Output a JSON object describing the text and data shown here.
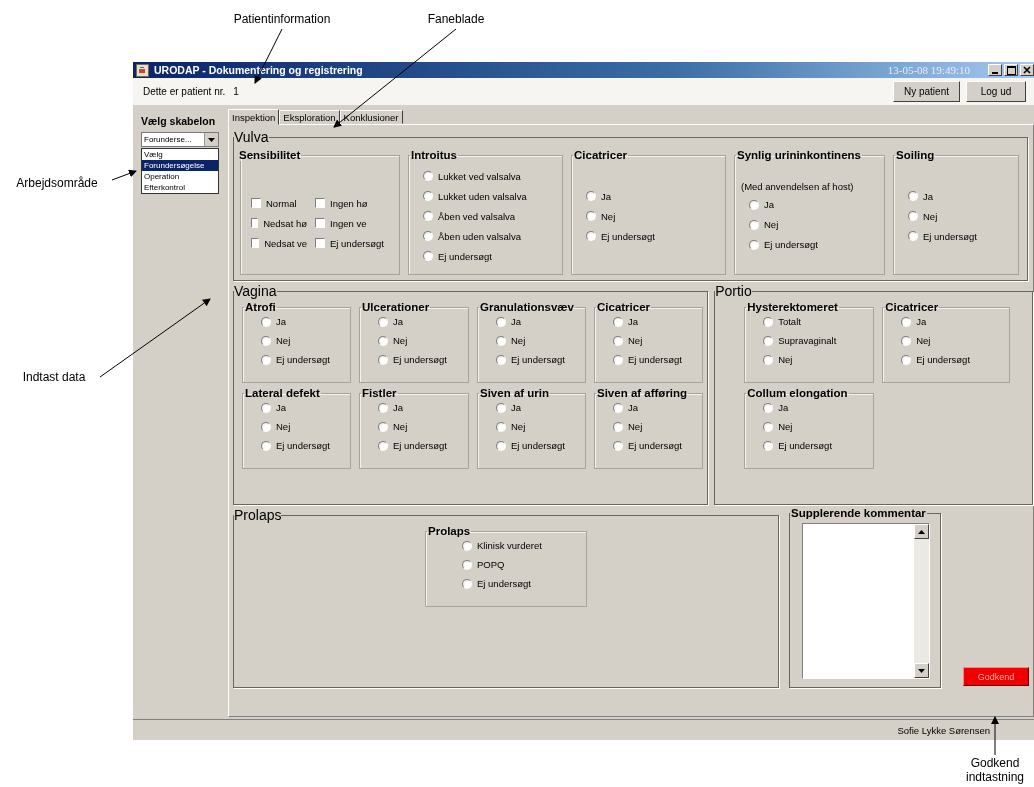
{
  "annotations": [
    {
      "text": "Patientinformation"
    },
    {
      "text": "Faneblade"
    },
    {
      "text": "Arbejdsområde"
    },
    {
      "text": "Indtast data"
    },
    {
      "text": "Godkend indtastning"
    }
  ],
  "window": {
    "title": "URODAP - Dokumentering og registrering",
    "datetime": "13-05-08 19:49:10"
  },
  "patient_bar": {
    "label": "Dette er patient nr.",
    "number": "1",
    "buttons": [
      "Ny patient",
      "Log ud"
    ]
  },
  "sidebar": {
    "heading": "Vælg skabelon",
    "combo_value": "Forunderse...",
    "dropdown_items": [
      {
        "label": "Vælg",
        "selected": false
      },
      {
        "label": "Forundersøgelse",
        "selected": true
      },
      {
        "label": "Operation",
        "selected": false
      },
      {
        "label": "Efterkontrol",
        "selected": false
      }
    ]
  },
  "tabs": [
    {
      "label": "Inspektion",
      "selected": true
    },
    {
      "label": "Eksploration",
      "selected": false
    },
    {
      "label": "Konklusioner",
      "selected": false
    }
  ],
  "sections": [
    {
      "title": "Vulva",
      "groups": [
        {
          "title": "Sensibilitet",
          "kind": "checkbox",
          "options": [
            {
              "label": "Normal",
              "checked": false
            },
            {
              "label": "Nedsat hø",
              "checked": false
            },
            {
              "label": "Nedsat ve",
              "checked": false
            },
            {
              "label": "Ingen hø",
              "checked": false
            },
            {
              "label": "Ingen ve",
              "checked": false
            },
            {
              "label": "Ej undersøgt",
              "checked": false
            }
          ]
        },
        {
          "title": "Introitus",
          "kind": "radio",
          "options": [
            {
              "label": "Lukket ved valsalva",
              "selected": false
            },
            {
              "label": "Lukket uden valsalva",
              "selected": false
            },
            {
              "label": "Åben ved valsalva",
              "selected": false
            },
            {
              "label": "Åben uden valsalva",
              "selected": false
            },
            {
              "label": "Ej undersøgt",
              "selected": false
            }
          ]
        },
        {
          "title": "Cicatricer",
          "kind": "radio",
          "options": [
            {
              "label": "Ja",
              "selected": false
            },
            {
              "label": "Nej",
              "selected": false
            },
            {
              "label": "Ej undersøgt",
              "selected": false
            }
          ]
        },
        {
          "title": "Synlig urininkontinens",
          "kind": "radio",
          "note": "(Med anvendelsen af host)",
          "options": [
            {
              "label": "Ja",
              "selected": false
            },
            {
              "label": "Nej",
              "selected": false
            },
            {
              "label": "Ej undersøgt",
              "selected": false
            }
          ]
        },
        {
          "title": "Soiling",
          "kind": "radio",
          "options": [
            {
              "label": "Ja",
              "selected": false
            },
            {
              "label": "Nej",
              "selected": false
            },
            {
              "label": "Ej undersøgt",
              "selected": false
            }
          ]
        }
      ]
    },
    {
      "title": "Vagina",
      "groups": [
        {
          "title": "Atrofi",
          "kind": "radio",
          "options": [
            {
              "label": "Ja",
              "selected": false
            },
            {
              "label": "Nej",
              "selected": false
            },
            {
              "label": "Ej undersøgt",
              "selected": false
            }
          ]
        },
        {
          "title": "Ulcerationer",
          "kind": "radio",
          "options": [
            {
              "label": "Ja",
              "selected": false
            },
            {
              "label": "Nej",
              "selected": false
            },
            {
              "label": "Ej undersøgt",
              "selected": false
            }
          ]
        },
        {
          "title": "Granulationsvæv",
          "kind": "radio",
          "options": [
            {
              "label": "Ja",
              "selected": false
            },
            {
              "label": "Nej",
              "selected": false
            },
            {
              "label": "Ej undersøgt",
              "selected": false
            }
          ]
        },
        {
          "title": "Cicatricer",
          "kind": "radio",
          "options": [
            {
              "label": "Ja",
              "selected": false
            },
            {
              "label": "Nej",
              "selected": false
            },
            {
              "label": "Ej undersøgt",
              "selected": false
            }
          ]
        },
        {
          "title": "Lateral defekt",
          "kind": "radio",
          "options": [
            {
              "label": "Ja",
              "selected": false
            },
            {
              "label": "Nej",
              "selected": false
            },
            {
              "label": "Ej undersøgt",
              "selected": false
            }
          ]
        },
        {
          "title": "Fistler",
          "kind": "radio",
          "options": [
            {
              "label": "Ja",
              "selected": false
            },
            {
              "label": "Nej",
              "selected": false
            },
            {
              "label": "Ej undersøgt",
              "selected": false
            }
          ]
        },
        {
          "title": "Siven af urin",
          "kind": "radio",
          "options": [
            {
              "label": "Ja",
              "selected": false
            },
            {
              "label": "Nej",
              "selected": false
            },
            {
              "label": "Ej undersøgt",
              "selected": false
            }
          ]
        },
        {
          "title": "Siven af afføring",
          "kind": "radio",
          "options": [
            {
              "label": "Ja",
              "selected": false
            },
            {
              "label": "Nej",
              "selected": false
            },
            {
              "label": "Ej undersøgt",
              "selected": false
            }
          ]
        }
      ]
    },
    {
      "title": "Portio",
      "groups": [
        {
          "title": "Hysterektomeret",
          "kind": "radio",
          "options": [
            {
              "label": "Totalt",
              "selected": false
            },
            {
              "label": "Supravaginalt",
              "selected": false
            },
            {
              "label": "Nej",
              "selected": false
            }
          ]
        },
        {
          "title": "Cicatricer",
          "kind": "radio",
          "options": [
            {
              "label": "Ja",
              "selected": false
            },
            {
              "label": "Nej",
              "selected": false
            },
            {
              "label": "Ej undersøgt",
              "selected": false
            }
          ]
        },
        {
          "title": "Collum elongation",
          "kind": "radio",
          "options": [
            {
              "label": "Ja",
              "selected": false
            },
            {
              "label": "Nej",
              "selected": false
            },
            {
              "label": "Ej undersøgt",
              "selected": false
            }
          ]
        }
      ]
    },
    {
      "title": "Prolaps",
      "groups": [
        {
          "title": "Prolaps",
          "kind": "radio",
          "options": [
            {
              "label": "Klinisk vurderet",
              "selected": false
            },
            {
              "label": "POPQ",
              "selected": false
            },
            {
              "label": "Ej undersøgt",
              "selected": false
            }
          ]
        }
      ]
    }
  ],
  "comment": {
    "title": "Supplerende kommentar"
  },
  "submit_button": "Godkend",
  "status_bar": {
    "user": "Sofie Lykke Sørensen"
  }
}
